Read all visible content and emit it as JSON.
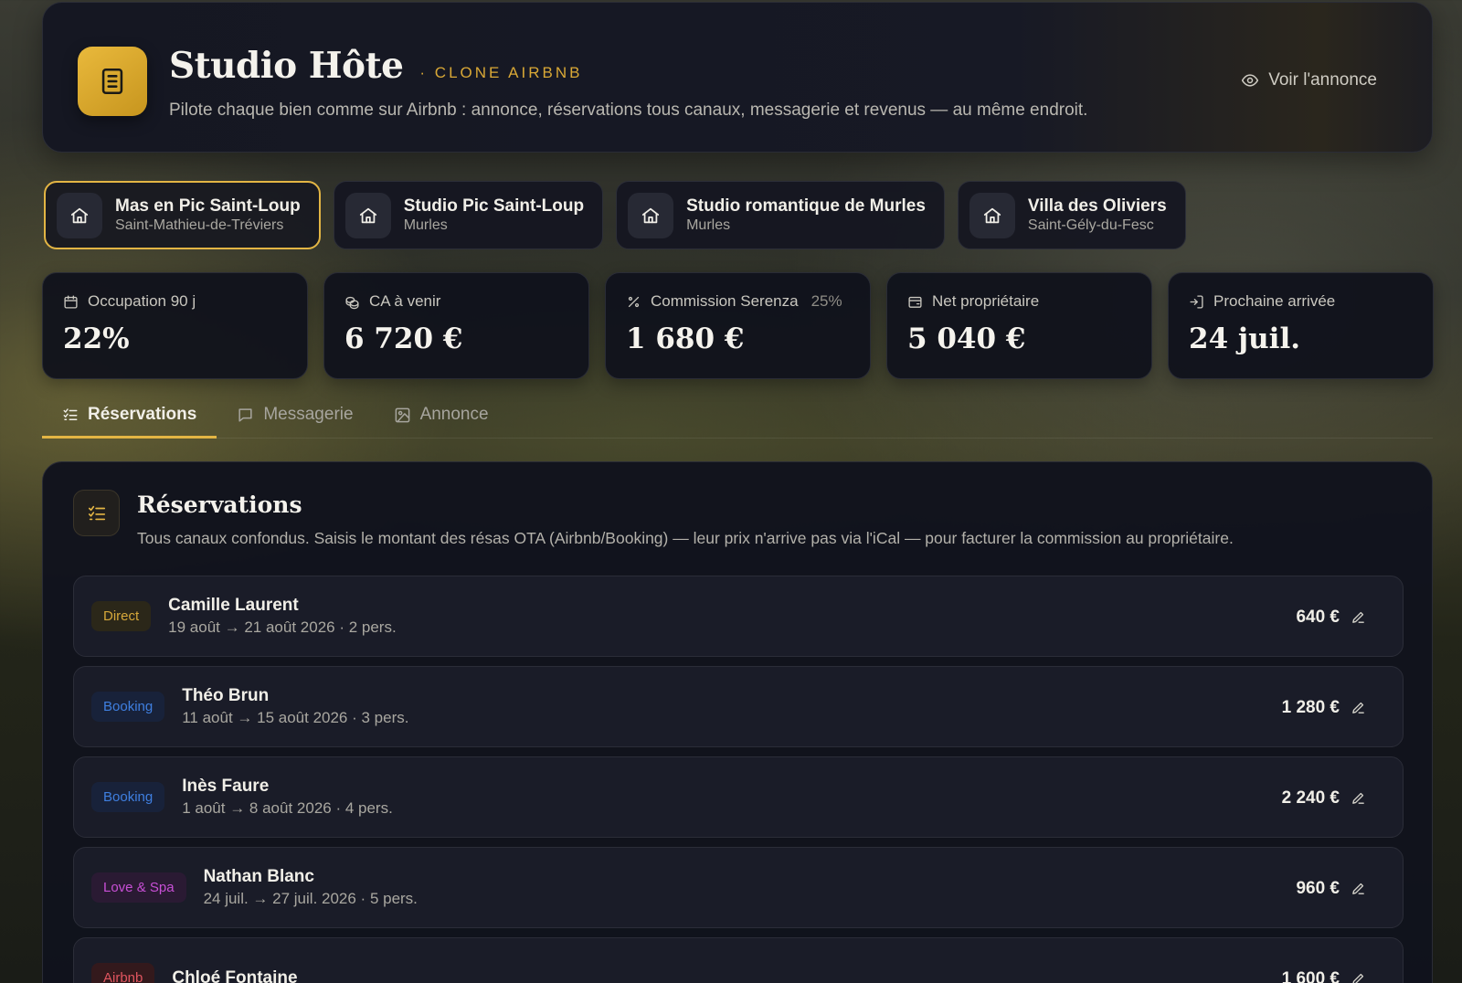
{
  "app": {
    "title": "Studio Hôte",
    "subtitle": "· CLONE AIRBNB",
    "description": "Pilote chaque bien comme sur Airbnb : annonce, réservations tous canaux, messagerie et revenus — au même endroit.",
    "view_listing": "Voir l'annonce"
  },
  "properties": [
    {
      "name": "Mas en Pic Saint-Loup",
      "city": "Saint-Mathieu-de-Tréviers",
      "active": true
    },
    {
      "name": "Studio Pic Saint-Loup",
      "city": "Murles",
      "active": false
    },
    {
      "name": "Studio romantique de Murles",
      "city": "Murles",
      "active": false
    },
    {
      "name": "Villa des Oliviers",
      "city": "Saint-Gély-du-Fesc",
      "active": false
    }
  ],
  "kpis": [
    {
      "icon": "calendar-icon",
      "label": "Occupation 90 j",
      "extra": "",
      "value": "22%"
    },
    {
      "icon": "coins-icon",
      "label": "CA à venir",
      "extra": "",
      "value": "6 720 €"
    },
    {
      "icon": "percent-icon",
      "label": "Commission Serenza",
      "extra": "25%",
      "value": "1 680 €"
    },
    {
      "icon": "wallet-icon",
      "label": "Net propriétaire",
      "extra": "",
      "value": "5 040 €"
    },
    {
      "icon": "login-icon",
      "label": "Prochaine arrivée",
      "extra": "",
      "value": "24 juil."
    }
  ],
  "tabs": [
    {
      "label": "Réservations",
      "icon": "list-check-icon",
      "active": true
    },
    {
      "label": "Messagerie",
      "icon": "message-icon",
      "active": false
    },
    {
      "label": "Annonce",
      "icon": "image-icon",
      "active": false
    }
  ],
  "reservations_panel": {
    "title": "Réservations",
    "description": "Tous canaux confondus. Saisis le montant des résas OTA (Airbnb/Booking) — leur prix n'arrive pas via l'iCal — pour facturer la commission au propriétaire.",
    "items": [
      {
        "channel": "Direct",
        "guest": "Camille Laurent",
        "dates": "19 août → 21 août 2026 · 2 pers.",
        "amount": "640 €"
      },
      {
        "channel": "Booking",
        "guest": "Théo Brun",
        "dates": "11 août → 15 août 2026 · 3 pers.",
        "amount": "1 280 €"
      },
      {
        "channel": "Booking",
        "guest": "Inès Faure",
        "dates": "1 août → 8 août 2026 · 4 pers.",
        "amount": "2 240 €"
      },
      {
        "channel": "Love & Spa",
        "guest": "Nathan Blanc",
        "dates": "24 juil. → 27 juil. 2026 · 5 pers.",
        "amount": "960 €"
      },
      {
        "channel": "Airbnb",
        "guest": "Chloé Fontaine",
        "dates": "",
        "amount": "1 600 €"
      }
    ]
  },
  "channel_colors": {
    "Direct": {
      "bg": "#2b2719",
      "fg": "#d6a83a"
    },
    "Booking": {
      "bg": "#18223a",
      "fg": "#3f7fe0"
    },
    "Love & Spa": {
      "bg": "#2a1a33",
      "fg": "#c84fd6"
    },
    "Airbnb": {
      "bg": "#33191c",
      "fg": "#e0555f"
    }
  },
  "colors": {
    "accent": "#e3b544",
    "panel": "#11131d"
  }
}
